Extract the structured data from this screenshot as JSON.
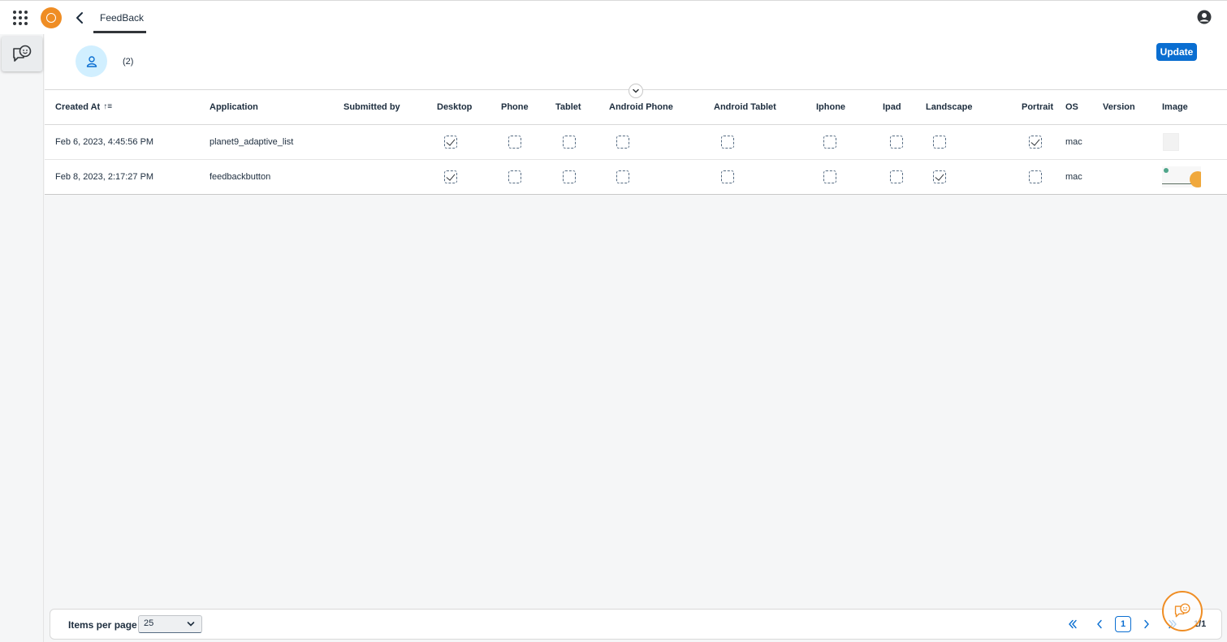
{
  "header": {
    "tab_label": "FeedBack"
  },
  "summary": {
    "count": "(2)",
    "update_label": "Update"
  },
  "table": {
    "columns": [
      "Created At",
      "Application",
      "Submitted by",
      "Desktop",
      "Phone",
      "Tablet",
      "Android Phone",
      "Android Tablet",
      "Iphone",
      "Ipad",
      "Landscape",
      "Portrait",
      "OS",
      "Version",
      "Image"
    ],
    "rows": [
      {
        "created_at": "Feb 6, 2023, 4:45:56 PM",
        "application": "planet9_adaptive_list",
        "submitted_by": "",
        "desktop": true,
        "phone": false,
        "tablet": false,
        "android_phone": false,
        "android_tablet": false,
        "iphone": false,
        "ipad": false,
        "landscape": false,
        "portrait": true,
        "os": "mac",
        "version": ""
      },
      {
        "created_at": "Feb 8, 2023, 2:17:27 PM",
        "application": "feedbackbutton",
        "submitted_by": "",
        "desktop": true,
        "phone": false,
        "tablet": false,
        "android_phone": false,
        "android_tablet": false,
        "iphone": false,
        "ipad": false,
        "landscape": true,
        "portrait": false,
        "os": "mac",
        "version": ""
      }
    ]
  },
  "footer": {
    "items_per_page_label": "Items per page",
    "items_per_page_value": "25",
    "current_page": "1",
    "page_total": "1/1"
  },
  "colors": {
    "accent": "#0a6ed1",
    "brand": "#ef8d24"
  }
}
